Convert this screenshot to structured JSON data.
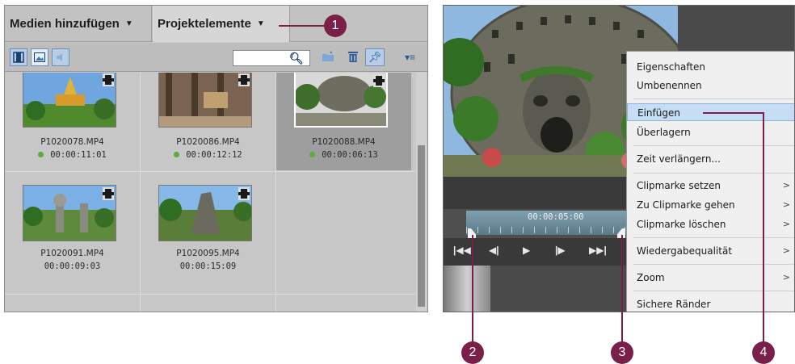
{
  "left_panel": {
    "tabs": [
      {
        "label": "Medien hinzufügen"
      },
      {
        "label": "Projektelemente"
      }
    ],
    "items": [
      {
        "name": "P1020078.MP4",
        "duration": "00:00:11:01",
        "status_dot": true
      },
      {
        "name": "P1020086.MP4",
        "duration": "00:00:12:12",
        "status_dot": true
      },
      {
        "name": "P1020088.MP4",
        "duration": "00:00:06:13",
        "status_dot": true,
        "selected": true
      },
      {
        "name": "P1020091.MP4",
        "duration": "00:00:09:03",
        "status_dot": false
      },
      {
        "name": "P1020095.MP4",
        "duration": "00:00:15:09",
        "status_dot": false
      }
    ],
    "colors": {
      "status_dot": "#5eaa3c"
    }
  },
  "right_panel": {
    "timeline_time": "00:00:05:00",
    "context_menu": [
      {
        "label": "Eigenschaften"
      },
      {
        "label": "Umbenennen"
      },
      {
        "label": "Einfügen",
        "highlighted": true
      },
      {
        "label": "Überlagern"
      },
      {
        "label": "Zeit verlängern..."
      },
      {
        "label": "Clipmarke setzen",
        "submenu": true
      },
      {
        "label": "Zu Clipmarke gehen",
        "submenu": true
      },
      {
        "label": "Clipmarke löschen",
        "submenu": true
      },
      {
        "label": "Wiedergabequalität",
        "submenu": true
      },
      {
        "label": "Zoom",
        "submenu": true
      },
      {
        "label": "Sichere Ränder"
      }
    ]
  },
  "callouts": [
    "1",
    "2",
    "3",
    "4"
  ],
  "colors": {
    "callout": "#7a1f4a",
    "menu_highlight": "#c6ddf5"
  }
}
